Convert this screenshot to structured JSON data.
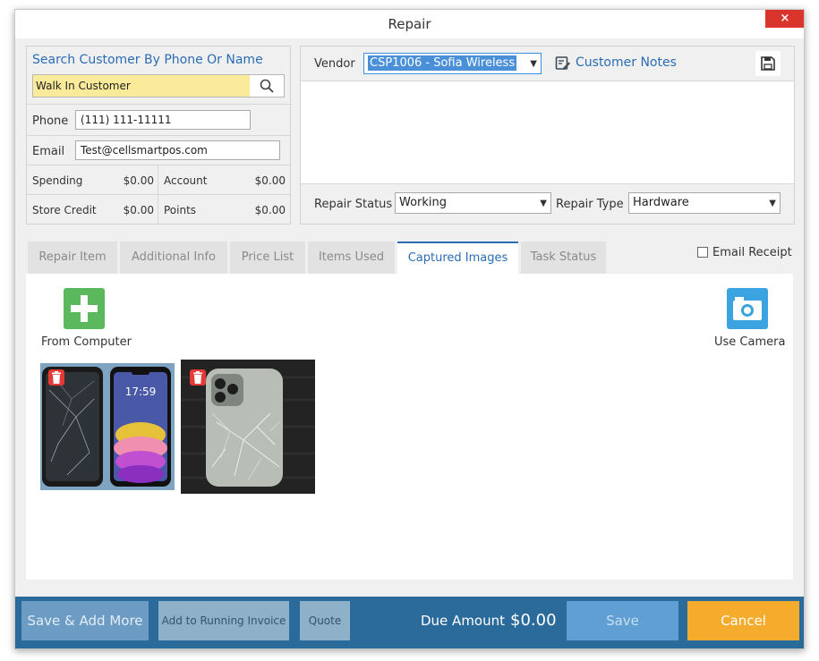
{
  "window": {
    "title": "Repair",
    "close_label": "×"
  },
  "customer": {
    "search_label": "Search Customer By Phone Or Name",
    "search_value": "Walk In Customer",
    "phone_label": "Phone",
    "phone_value": "(111) 111-11111",
    "email_label": "Email",
    "email_value": "Test@cellsmartpos.com",
    "spending_label": "Spending",
    "spending_value": "$0.00",
    "account_label": "Account",
    "account_value": "$0.00",
    "store_credit_label": "Store Credit",
    "store_credit_value": "$0.00",
    "points_label": "Points",
    "points_value": "$0.00"
  },
  "vendor": {
    "label": "Vendor",
    "selected": "CSP1006 - Sofia Wireless",
    "notes_label": "Customer Notes",
    "repair_status_label": "Repair Status",
    "repair_status_value": "Working",
    "repair_type_label": "Repair Type",
    "repair_type_value": "Hardware"
  },
  "tabs": [
    {
      "label": "Repair Item"
    },
    {
      "label": "Additional Info"
    },
    {
      "label": "Price List"
    },
    {
      "label": "Items Used"
    },
    {
      "label": "Captured Images",
      "active": true
    },
    {
      "label": "Task Status"
    }
  ],
  "email_receipt_label": "Email Receipt",
  "images": {
    "from_computer_label": "From Computer",
    "use_camera_label": "Use Camera",
    "phone_screen_time": "17:59"
  },
  "footer": {
    "save_add_more": "Save & Add More",
    "add_running_invoice": "Add to Running Invoice",
    "quote": "Quote",
    "due_label": "Due Amount",
    "due_value": "$0.00",
    "save": "Save",
    "cancel": "Cancel"
  },
  "colors": {
    "accent": "#2a6db5",
    "footer": "#2b6b9c",
    "cancel": "#f5ab2b",
    "add_green": "#5cb85c",
    "camera_blue": "#3aa3e0",
    "delete_red": "#e53935"
  }
}
